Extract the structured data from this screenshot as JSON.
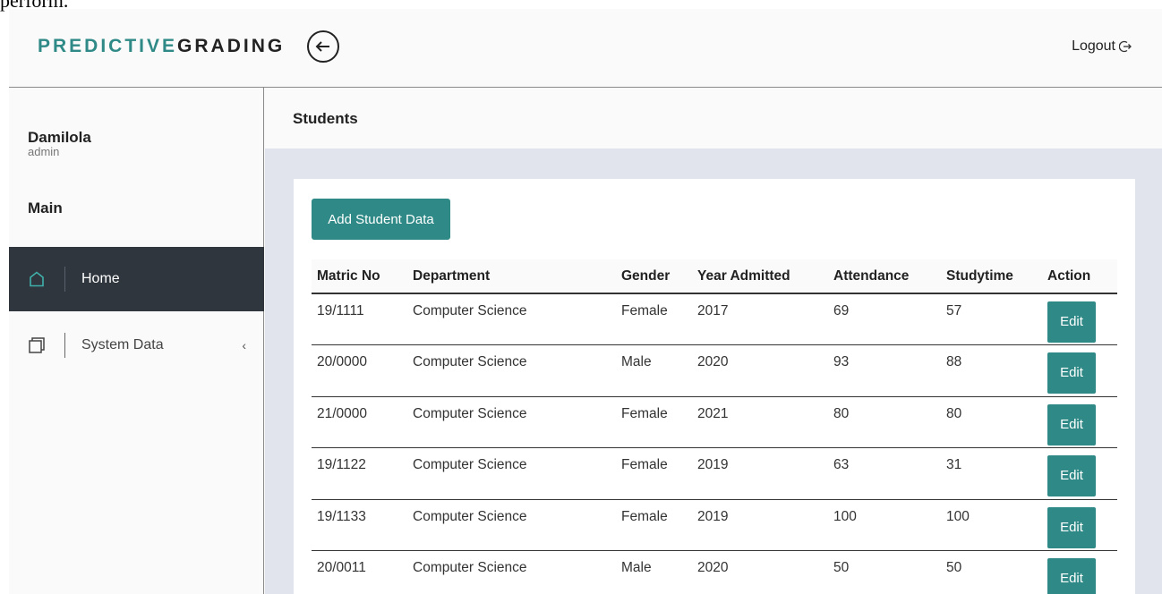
{
  "top_crop_text": "perform.",
  "header": {
    "brand_part1": "PREDICTIVE",
    "brand_part2": "GRADING",
    "logout_label": "Logout"
  },
  "sidebar": {
    "user_name": "Damilola",
    "user_role": "admin",
    "section_label": "Main",
    "items": [
      {
        "label": "Home",
        "icon": "home-icon",
        "active": true
      },
      {
        "label": "System Data",
        "icon": "layers-icon",
        "chevron": "‹"
      }
    ]
  },
  "page": {
    "title": "Students",
    "add_button_label": "Add Student Data"
  },
  "table": {
    "columns": [
      "Matric No",
      "Department",
      "Gender",
      "Year Admitted",
      "Attendance",
      "Studytime",
      "Action"
    ],
    "edit_label": "Edit",
    "rows": [
      [
        "19/1111",
        "Computer Science",
        "Female",
        "2017",
        "69",
        "57"
      ],
      [
        "20/0000",
        "Computer Science",
        "Male",
        "2020",
        "93",
        "88"
      ],
      [
        "21/0000",
        "Computer Science",
        "Female",
        "2021",
        "80",
        "80"
      ],
      [
        "19/1122",
        "Computer Science",
        "Female",
        "2019",
        "63",
        "31"
      ],
      [
        "19/1133",
        "Computer Science",
        "Female",
        "2019",
        "100",
        "100"
      ],
      [
        "20/0011",
        "Computer Science",
        "Male",
        "2020",
        "50",
        "50"
      ]
    ]
  },
  "colors": {
    "accent": "#2f8a87",
    "sidebar_active": "#2f363e",
    "content_bg": "#e1e4ec"
  }
}
